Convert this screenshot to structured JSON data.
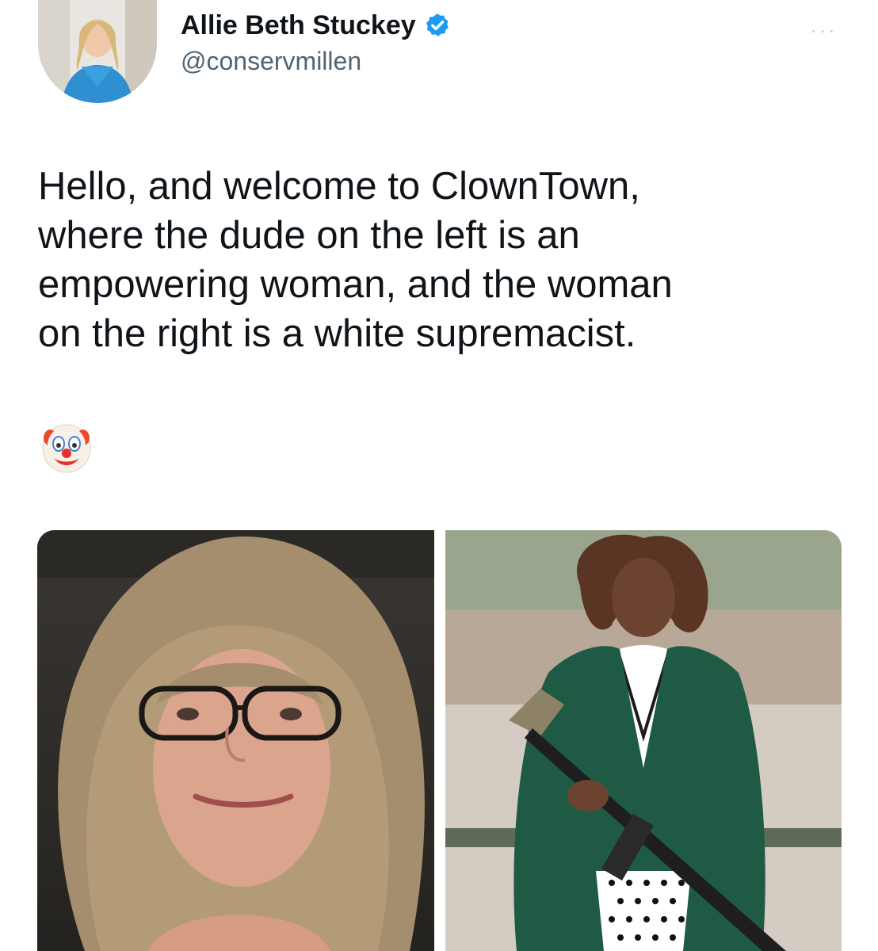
{
  "author": {
    "display_name": "Allie Beth Stuckey",
    "handle": "@conservmillen",
    "verified": true
  },
  "tweet": {
    "text": "Hello, and welcome to ClownTown,\nwhere the dude on the left is an\nempowering woman, and the woman\non the right is a white supremacist.",
    "emoji": "clown-face-icon"
  },
  "media": {
    "count": 2
  },
  "colors": {
    "verified": "#1d9bf0",
    "text": "#0f1419",
    "secondary": "#536471"
  }
}
